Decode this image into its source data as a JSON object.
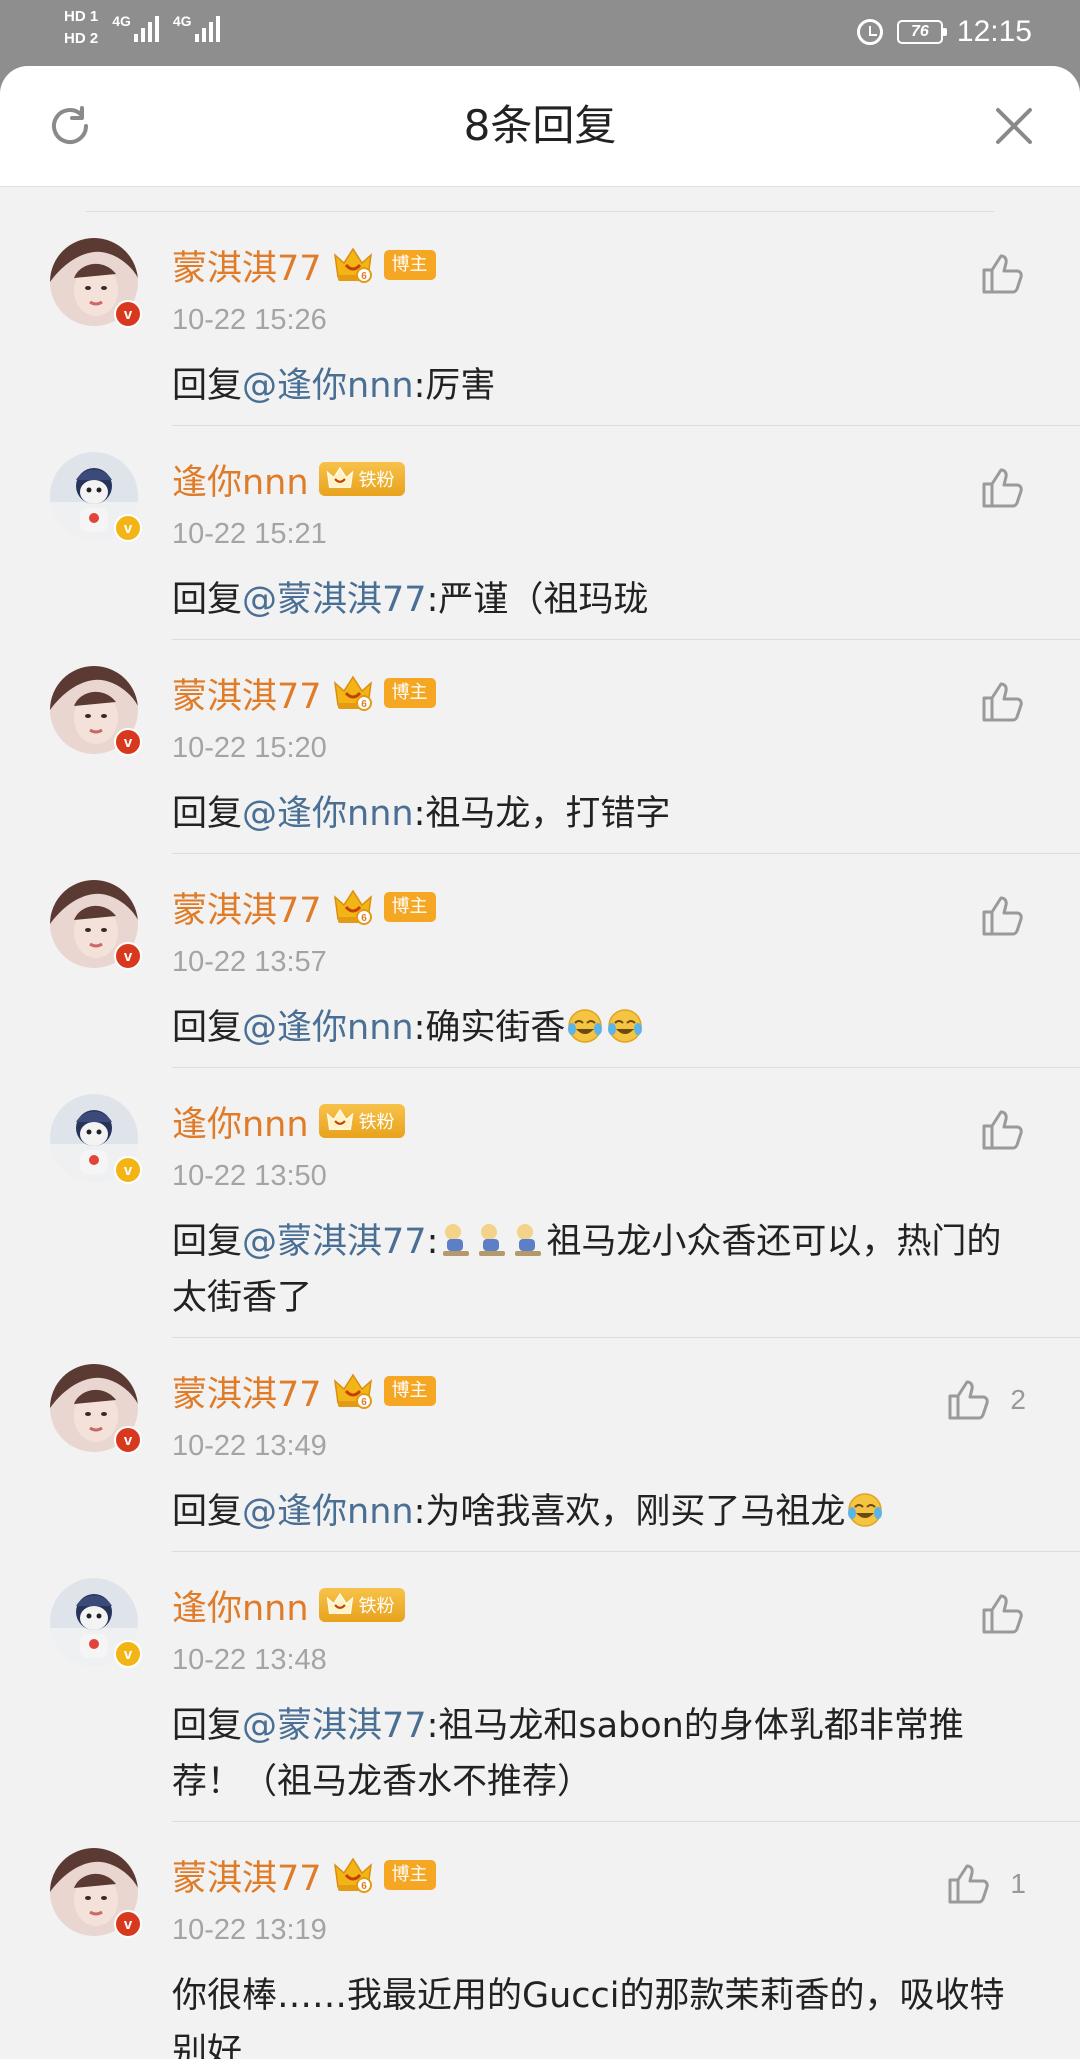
{
  "status_bar": {
    "hd1": "HD 1",
    "hd2": "HD 2",
    "net1": "4G",
    "net2": "4G",
    "battery": "76",
    "time": "12:15"
  },
  "header": {
    "title": "8条回复",
    "refresh_icon": "refresh-icon",
    "close_icon": "close-icon"
  },
  "badges": {
    "blogger": "博主",
    "iron_fan": "铁粉"
  },
  "comments": [
    {
      "author": "蒙淇淇77",
      "role": "blogger",
      "time": "10-22 15:26",
      "prefix": "回复",
      "mention": "@逢你nnn",
      "text": ":厉害",
      "likes": ""
    },
    {
      "author": "逢你nnn",
      "role": "iron_fan",
      "time": "10-22 15:21",
      "prefix": "回复",
      "mention": "@蒙淇淇77",
      "text": ":严谨（祖玛珑",
      "likes": ""
    },
    {
      "author": "蒙淇淇77",
      "role": "blogger",
      "time": "10-22 15:20",
      "prefix": "回复",
      "mention": "@逢你nnn",
      "text": ":祖马龙，打错字",
      "likes": ""
    },
    {
      "author": "蒙淇淇77",
      "role": "blogger",
      "time": "10-22 13:57",
      "prefix": "回复",
      "mention": "@逢你nnn",
      "text": ":确实街香",
      "likes": ""
    },
    {
      "author": "逢你nnn",
      "role": "iron_fan",
      "time": "10-22 13:50",
      "prefix": "回复",
      "mention": "@蒙淇淇77",
      "text": ":",
      "text2": "祖马龙小众香还可以，热门的太街香了",
      "likes": ""
    },
    {
      "author": "蒙淇淇77",
      "role": "blogger",
      "time": "10-22 13:49",
      "prefix": "回复",
      "mention": "@逢你nnn",
      "text": ":为啥我喜欢，刚买了马祖龙",
      "likes": "2"
    },
    {
      "author": "逢你nnn",
      "role": "iron_fan",
      "time": "10-22 13:48",
      "prefix": "回复",
      "mention": "@蒙淇淇77",
      "text": ":祖马龙和sabon的身体乳都非常推荐！（祖马龙香水不推荐）",
      "likes": ""
    },
    {
      "author": "蒙淇淇77",
      "role": "blogger",
      "time": "10-22 13:19",
      "prefix": "",
      "mention": "",
      "text": "你很棒……我最近用的Gucci的那款茉莉香的，吸收特别好",
      "likes": "1"
    }
  ],
  "colors": {
    "name": "#e07b28",
    "mention": "#4a6f94",
    "time": "#a4a4a4",
    "blogger_tag": "#f5a623",
    "verified_red": "#d8381e",
    "verified_gold": "#f2b515"
  }
}
